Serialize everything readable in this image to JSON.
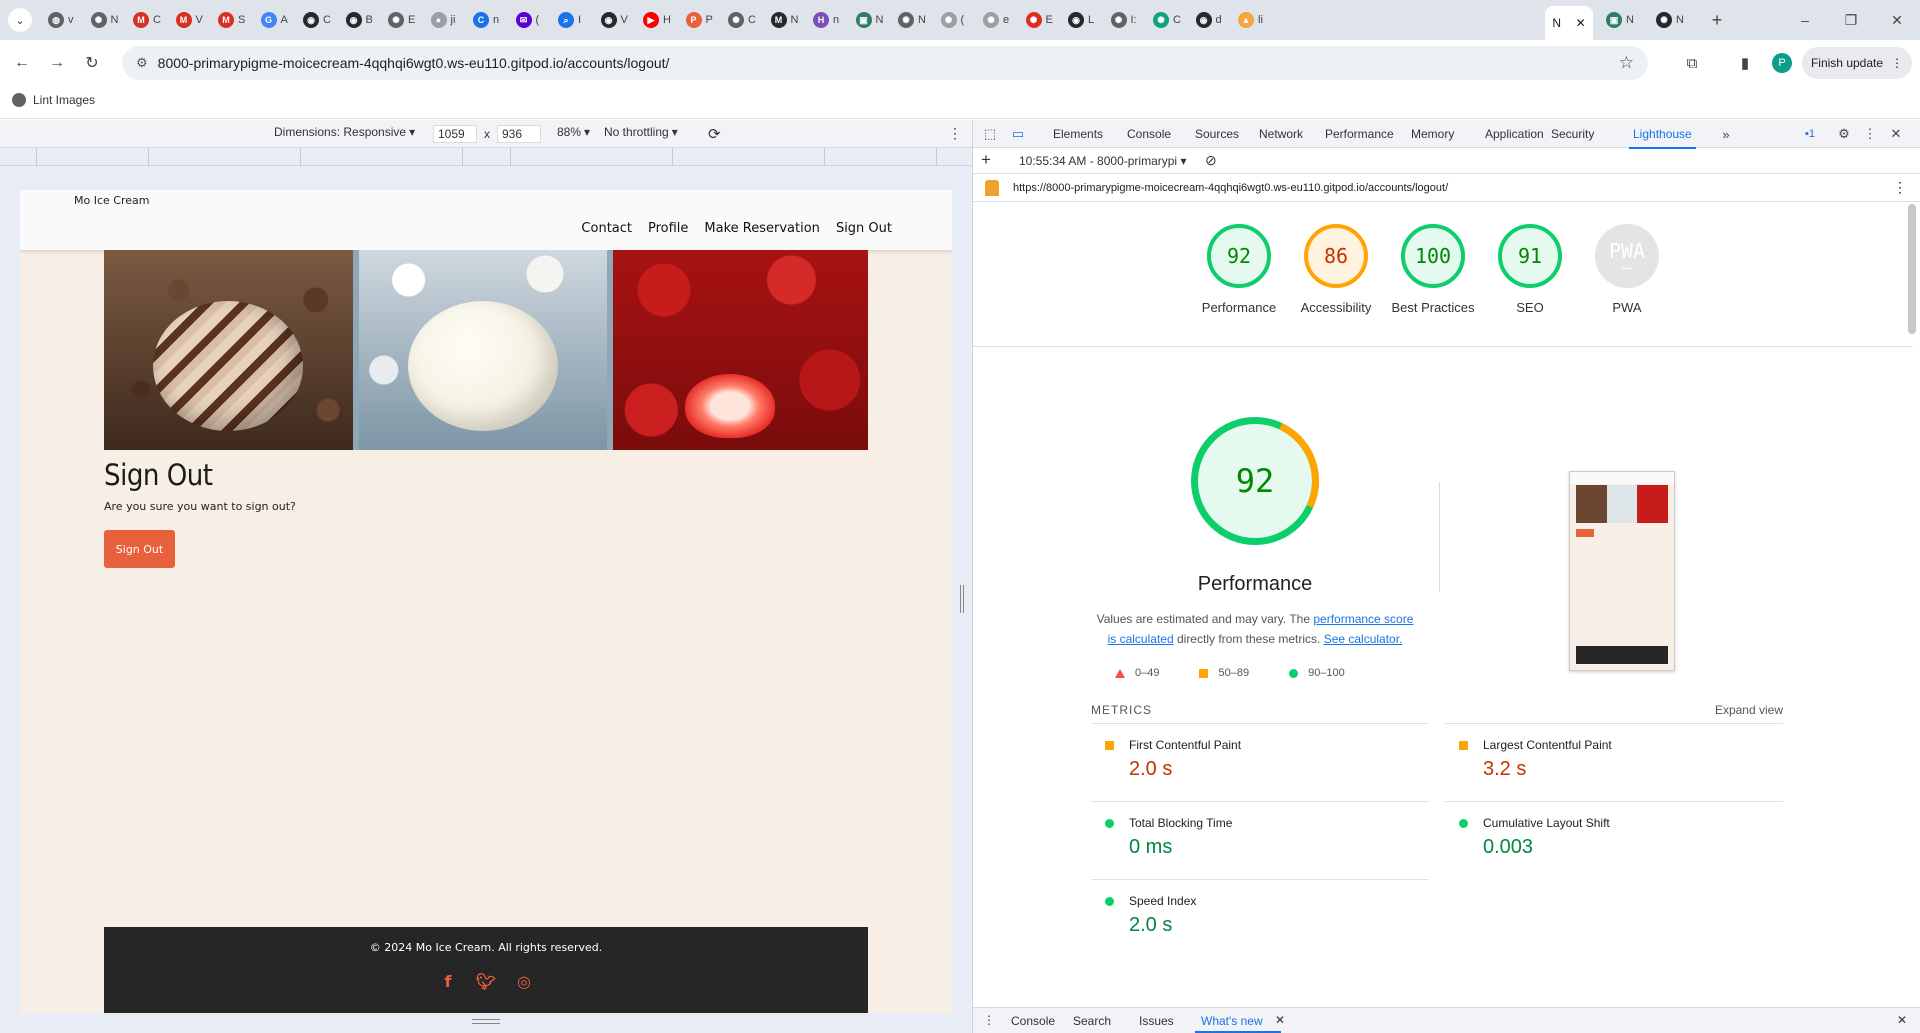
{
  "browser": {
    "tabs": [
      {
        "icon": "globe-icon",
        "color": "#5f6368",
        "label": "v"
      },
      {
        "icon": "gear-icon",
        "color": "#5f6368",
        "label": "N"
      },
      {
        "icon": "gmail-icon",
        "color": "#d93025",
        "label": "C"
      },
      {
        "icon": "gmail-icon",
        "color": "#d93025",
        "label": "V"
      },
      {
        "icon": "gmail-icon",
        "color": "#d93025",
        "label": "S"
      },
      {
        "icon": "google-icon",
        "color": "#4285f4",
        "label": "A"
      },
      {
        "icon": "github-icon",
        "color": "#24292f",
        "label": "C"
      },
      {
        "icon": "github-icon",
        "color": "#24292f",
        "label": "B"
      },
      {
        "icon": "openai-icon",
        "color": "#5f6368",
        "label": "E"
      },
      {
        "icon": "generic-icon",
        "color": "#9aa0a6",
        "label": "ji"
      },
      {
        "icon": "c-icon",
        "color": "#1a73e8",
        "label": "n"
      },
      {
        "icon": "mail-icon",
        "color": "#6001d2",
        "label": "("
      },
      {
        "icon": "search-icon",
        "color": "#1a73e8",
        "label": "I"
      },
      {
        "icon": "github-icon",
        "color": "#24292f",
        "label": "V"
      },
      {
        "icon": "youtube-icon",
        "color": "#ff0000",
        "label": "H"
      },
      {
        "icon": "p-icon",
        "color": "#e8603c",
        "label": "P"
      },
      {
        "icon": "openai-icon",
        "color": "#5f6368",
        "label": "C"
      },
      {
        "icon": "markdown-icon",
        "color": "#24292f",
        "label": "N"
      },
      {
        "icon": "h-icon",
        "color": "#7b4fb5",
        "label": "n"
      },
      {
        "icon": "image-icon",
        "color": "#2e7d6b",
        "label": "N"
      },
      {
        "icon": "openai-icon",
        "color": "#5f6368",
        "label": "N"
      },
      {
        "icon": "openai-icon",
        "color": "#9aa0a6",
        "label": "("
      },
      {
        "icon": "openai-icon",
        "color": "#9aa0a6",
        "label": "e"
      },
      {
        "icon": "openai-icon",
        "color": "#d93025",
        "label": "E"
      },
      {
        "icon": "github-icon",
        "color": "#24292f",
        "label": "L"
      },
      {
        "icon": "openai-icon",
        "color": "#5f6368",
        "label": "I:"
      },
      {
        "icon": "openai-icon",
        "color": "#10a37f",
        "label": "C"
      },
      {
        "icon": "github-icon",
        "color": "#24292f",
        "label": "d"
      },
      {
        "icon": "lighthouse-icon",
        "color": "#f4a740",
        "label": "li"
      }
    ],
    "active_tab": {
      "label": "N",
      "close": "✕"
    },
    "trailing_tabs": [
      {
        "icon": "image-icon",
        "color": "#2e7d6b",
        "label": "N"
      },
      {
        "icon": "openai-icon",
        "color": "#24292f",
        "label": "N"
      }
    ],
    "url": "8000-primarypigme-moicecream-4qqhqi6wgt0.ws-eu110.gitpod.io/accounts/logout/",
    "profile_initial": "P",
    "finish_update_label": "Finish update",
    "bookmark": "Lint Images"
  },
  "device_toolbar": {
    "dimensions_label": "Dimensions: Responsive",
    "width": "1059",
    "times": "x",
    "height": "936",
    "zoom": "88%",
    "throttling": "No throttling"
  },
  "site": {
    "brand": "Mo Ice Cream",
    "nav": [
      "Contact",
      "Profile",
      "Make Reservation",
      "Sign Out"
    ],
    "title": "Sign Out",
    "message": "Are you sure you want to sign out?",
    "button": "Sign Out",
    "footer_text": "© 2024 Mo Ice Cream. All rights reserved.",
    "social_icons": [
      "facebook-icon",
      "twitter-icon",
      "instagram-icon"
    ],
    "accent_color": "#e8603c"
  },
  "devtools": {
    "tabs": [
      "Elements",
      "Console",
      "Sources",
      "Network",
      "Performance",
      "Memory",
      "Application",
      "Security",
      "Lighthouse"
    ],
    "active_tab": "Lighthouse",
    "more": "»",
    "issues_count": "1",
    "report_time": "10:55:34 AM - 8000-primarypi",
    "report_url": "https://8000-primarypigme-moicecream-4qqhqi6wgt0.ws-eu110.gitpod.io/accounts/logout/",
    "scores": [
      {
        "label": "Performance",
        "value": "92",
        "status": "green"
      },
      {
        "label": "Accessibility",
        "value": "86",
        "status": "orange"
      },
      {
        "label": "Best Practices",
        "value": "100",
        "status": "green"
      },
      {
        "label": "SEO",
        "value": "91",
        "status": "green"
      },
      {
        "label": "PWA",
        "value": "PWA",
        "status": "na"
      }
    ],
    "performance": {
      "score": "92",
      "title": "Performance",
      "note_prefix": "Values are estimated and may vary. The ",
      "note_link1": "performance score is calculated",
      "note_mid": " directly from these metrics. ",
      "note_link2": "See calculator.",
      "legend": [
        "0–49",
        "50–89",
        "90–100"
      ],
      "metrics_header": "METRICS",
      "expand_label": "Expand view",
      "metrics": [
        {
          "name": "First Contentful Paint",
          "value": "2.0 s",
          "status": "orange"
        },
        {
          "name": "Largest Contentful Paint",
          "value": "3.2 s",
          "status": "orange"
        },
        {
          "name": "Total Blocking Time",
          "value": "0 ms",
          "status": "green"
        },
        {
          "name": "Cumulative Layout Shift",
          "value": "0.003",
          "status": "green"
        },
        {
          "name": "Speed Index",
          "value": "2.0 s",
          "status": "green"
        }
      ]
    },
    "drawer_tabs": [
      "Console",
      "Search",
      "Issues",
      "What's new"
    ],
    "drawer_active": "What's new"
  },
  "colors": {
    "green": "#0cce6b",
    "orange": "#ffa400",
    "red": "#ff4e42",
    "link": "#1a73e8"
  }
}
